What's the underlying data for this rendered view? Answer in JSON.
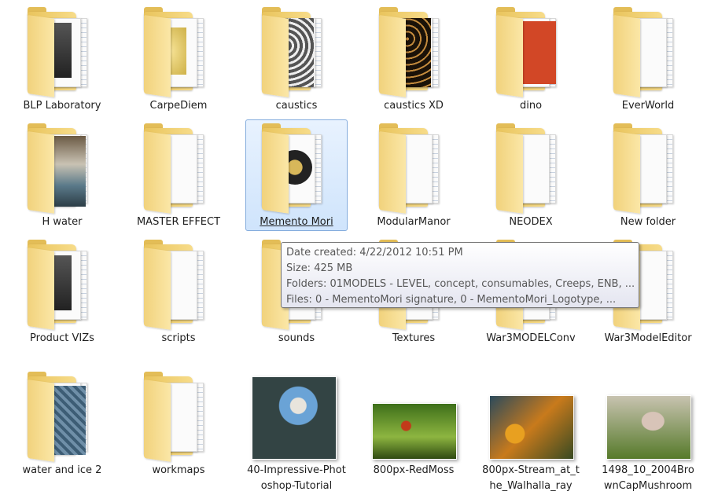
{
  "items": [
    {
      "label": "BLP Laboratory",
      "kind": "folder",
      "preview": "dark-doc"
    },
    {
      "label": "CarpeDiem",
      "kind": "folder",
      "preview": "yellow-doc"
    },
    {
      "label": "caustics",
      "kind": "folder",
      "preview": "caustics-gray"
    },
    {
      "label": "caustics XD",
      "kind": "folder",
      "preview": "caustics-dark"
    },
    {
      "label": "dino",
      "kind": "folder",
      "preview": "pdf-red"
    },
    {
      "label": "EverWorld",
      "kind": "folder",
      "preview": "blank"
    },
    {
      "label": "H water",
      "kind": "folder",
      "preview": "water-photo"
    },
    {
      "label": "MASTER EFFECT",
      "kind": "folder",
      "preview": "blank"
    },
    {
      "label": "Memento Mori",
      "kind": "folder",
      "preview": "logo",
      "selected": true
    },
    {
      "label": "ModularManor",
      "kind": "folder",
      "preview": "blank"
    },
    {
      "label": "NEODEX",
      "kind": "folder",
      "preview": "blank"
    },
    {
      "label": "New folder",
      "kind": "folder",
      "preview": "blank"
    },
    {
      "label": "Product VIZs",
      "kind": "folder",
      "preview": "dark-doc"
    },
    {
      "label": "scripts",
      "kind": "folder",
      "preview": "blank"
    },
    {
      "label": "sounds",
      "kind": "folder",
      "preview": "blank"
    },
    {
      "label": "Textures",
      "kind": "folder",
      "preview": "blank"
    },
    {
      "label": "War3MODELConv",
      "kind": "folder",
      "preview": "blank"
    },
    {
      "label": "War3ModelEditor",
      "kind": "folder",
      "preview": "blank"
    },
    {
      "label": "water and ice 2",
      "kind": "folder",
      "preview": "ice"
    },
    {
      "label": "workmaps",
      "kind": "folder",
      "preview": "blank"
    },
    {
      "label": "40-Impressive-Photoshop-Tutorial",
      "kind": "image",
      "preview": "smurf"
    },
    {
      "label": "800px-RedMoss",
      "kind": "image",
      "preview": "moss"
    },
    {
      "label": "800px-Stream_at_the_Walhalla_ray",
      "kind": "image",
      "preview": "stream"
    },
    {
      "label": "1498_10_2004BrownCapMushroom",
      "kind": "image",
      "preview": "mushroom"
    }
  ],
  "tooltip": {
    "line1": "Date created: 4/22/2012 10:51 PM",
    "line2": "Size: 425 MB",
    "line3": "Folders: 01MODELS - LEVEL, concept, consumables, Creeps, ENB, ...",
    "line4": "Files: 0 - MementoMori signature, 0 - MementoMori_Logotype, ..."
  },
  "colors": {
    "selection": "#cfe4fc",
    "selectionBorder": "#84acdd",
    "folder": "#f2cf6e"
  }
}
